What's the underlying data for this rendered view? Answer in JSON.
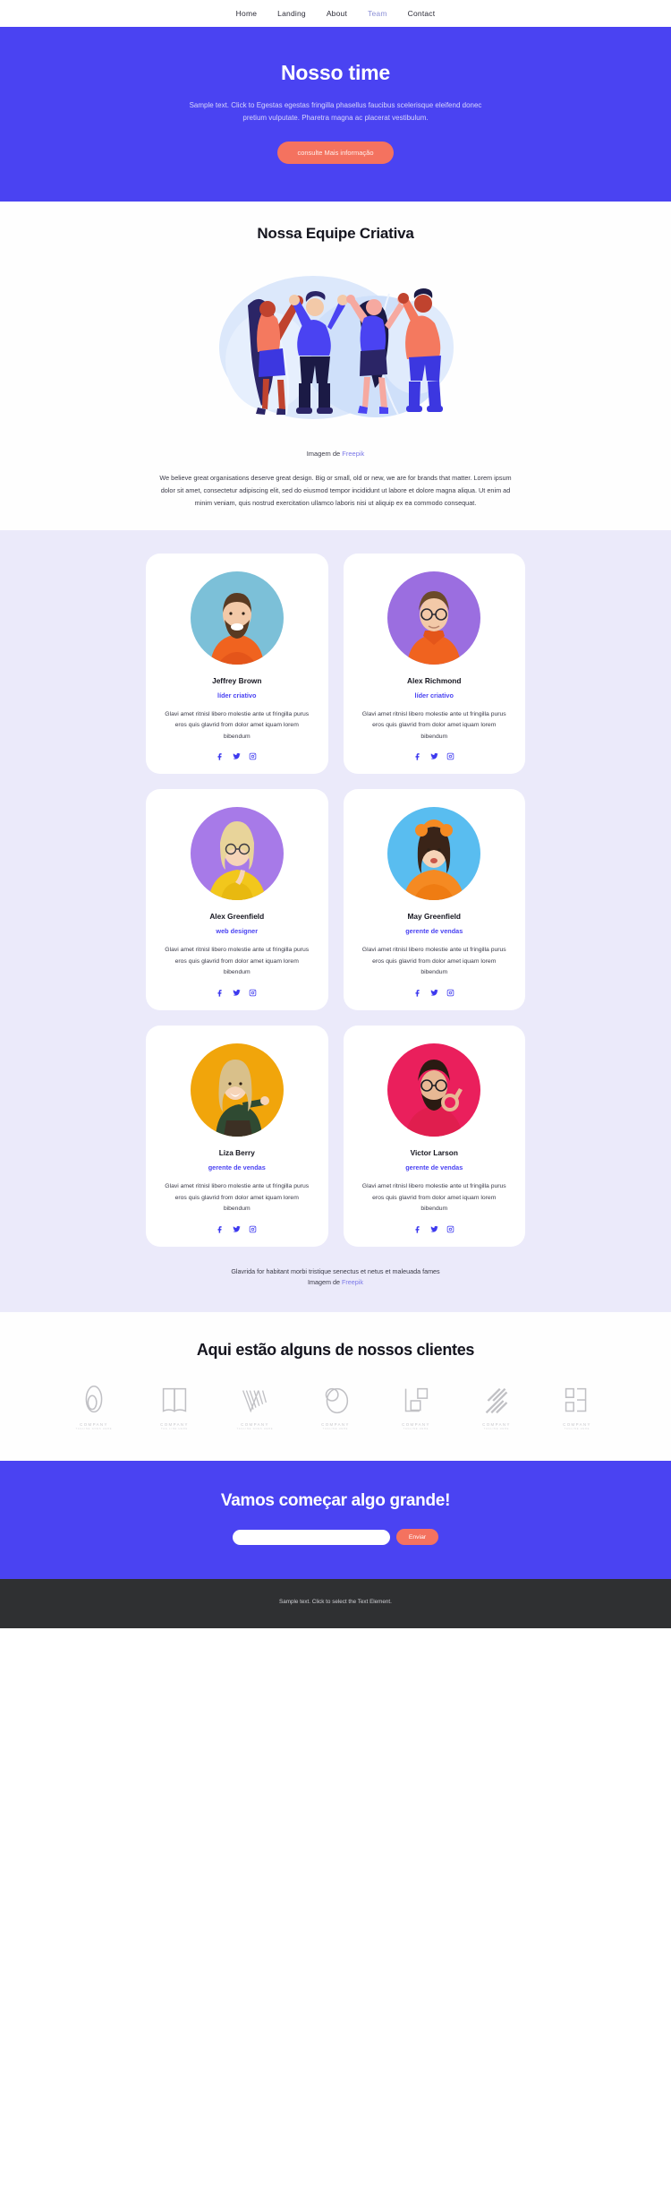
{
  "nav": {
    "items": [
      {
        "label": "Home",
        "active": false
      },
      {
        "label": "Landing",
        "active": false
      },
      {
        "label": "About",
        "active": false
      },
      {
        "label": "Team",
        "active": true
      },
      {
        "label": "Contact",
        "active": false
      }
    ]
  },
  "hero": {
    "title": "Nosso time",
    "subtitle": "Sample text. Click to Egestas egestas fringilla phasellus faucibus scelerisque eleifend donec pretium vulputate. Pharetra magna ac placerat vestibulum.",
    "button": "consulte Mais informação",
    "bg_color": "#4a43f2",
    "button_color": "#f4725f"
  },
  "creative": {
    "title": "Nossa Equipe Criativa",
    "credit_prefix": "Imagem de ",
    "credit_link": "Freepik",
    "paragraph": "We believe great organisations deserve great design. Big or small, old or new, we are for brands that matter. Lorem ipsum dolor sit amet, consectetur adipiscing elit, sed do eiusmod tempor incididunt ut labore et dolore magna aliqua. Ut enim ad minim veniam, quis nostrud exercitation ullamco laboris nisi ut aliquip ex ea commodo consequat."
  },
  "team": {
    "bio": "Glavi amet ritnisl libero molestie ante ut fringilla purus eros quis glavrid from dolor amet iquam lorem bibendum",
    "members": [
      {
        "name": "Jeffrey Brown",
        "role": "líder criativo",
        "photo_bg": "#7cc0d8",
        "shirt": "#f0631f",
        "hair": "#5a3a22",
        "skin": "#f3c9a8",
        "beard": true,
        "glasses": false
      },
      {
        "name": "Alex Richmond",
        "role": "líder criativo",
        "photo_bg": "#9b6ee0",
        "shirt": "#f0631f",
        "hair": "#6b4a2a",
        "skin": "#f3c9a8",
        "beard": false,
        "glasses": true
      },
      {
        "name": "Alex Greenfield",
        "role": "web designer",
        "photo_bg": "#a77ae8",
        "shirt": "#f2c71c",
        "hair": "#e8d49a",
        "skin": "#f6d4b8",
        "beard": false,
        "glasses": true
      },
      {
        "name": "May Greenfield",
        "role": "gerente de vendas",
        "photo_bg": "#59bdf0",
        "shirt": "#f58a22",
        "hair": "#3a2418",
        "skin": "#f6d4b8",
        "beard": false,
        "glasses": false
      },
      {
        "name": "Liza Berry",
        "role": "gerente de vendas",
        "photo_bg": "#f1a50b",
        "shirt": "#2f4a32",
        "hair": "#d9c08a",
        "skin": "#f6d4b8",
        "beard": false,
        "glasses": false
      },
      {
        "name": "Victor Larson",
        "role": "gerente de vendas",
        "photo_bg": "#ea1f5c",
        "shirt": "#e01e4e",
        "hair": "#2a1a12",
        "skin": "#e8b894",
        "beard": true,
        "glasses": true
      }
    ],
    "socials": [
      "facebook-icon",
      "twitter-icon",
      "instagram-icon"
    ],
    "caption": "Glavrida for habitant morbi tristique senectus et netus et maleuada fames",
    "caption_credit_prefix": "Imagem de ",
    "caption_credit_link": "Freepik",
    "role_color": "#4a43f2",
    "section_bg": "#ebeafa"
  },
  "clients": {
    "title": "Aqui estão alguns de nossos clientes",
    "logos": [
      {
        "name": "COMPANY",
        "tagline": "TAGLINE GOES HERE",
        "mark": "oval-loop-mark"
      },
      {
        "name": "COMPANY",
        "tagline": "TAG LINE HERE",
        "mark": "open-book-mark"
      },
      {
        "name": "COMPANY",
        "tagline": "TAGLINE GOES HERE",
        "mark": "chevron-lines-mark"
      },
      {
        "name": "COMPANY",
        "tagline": "TAGLINE HERE",
        "mark": "circle-overlap-mark"
      },
      {
        "name": "COMPANY",
        "tagline": "TAGLINE HERE",
        "mark": "squares-corner-mark"
      },
      {
        "name": "COMPANY",
        "tagline": "TAGLINE HERE",
        "mark": "diagonal-stripes-mark"
      },
      {
        "name": "COMPANY",
        "tagline": "TAGLINE HERE",
        "mark": "bracket-blocks-mark"
      }
    ]
  },
  "cta": {
    "title": "Vamos começar algo grande!",
    "input_value": "",
    "input_placeholder": "",
    "button": "Enviar"
  },
  "footer": {
    "text": "Sample text. Click to select the Text Element."
  }
}
